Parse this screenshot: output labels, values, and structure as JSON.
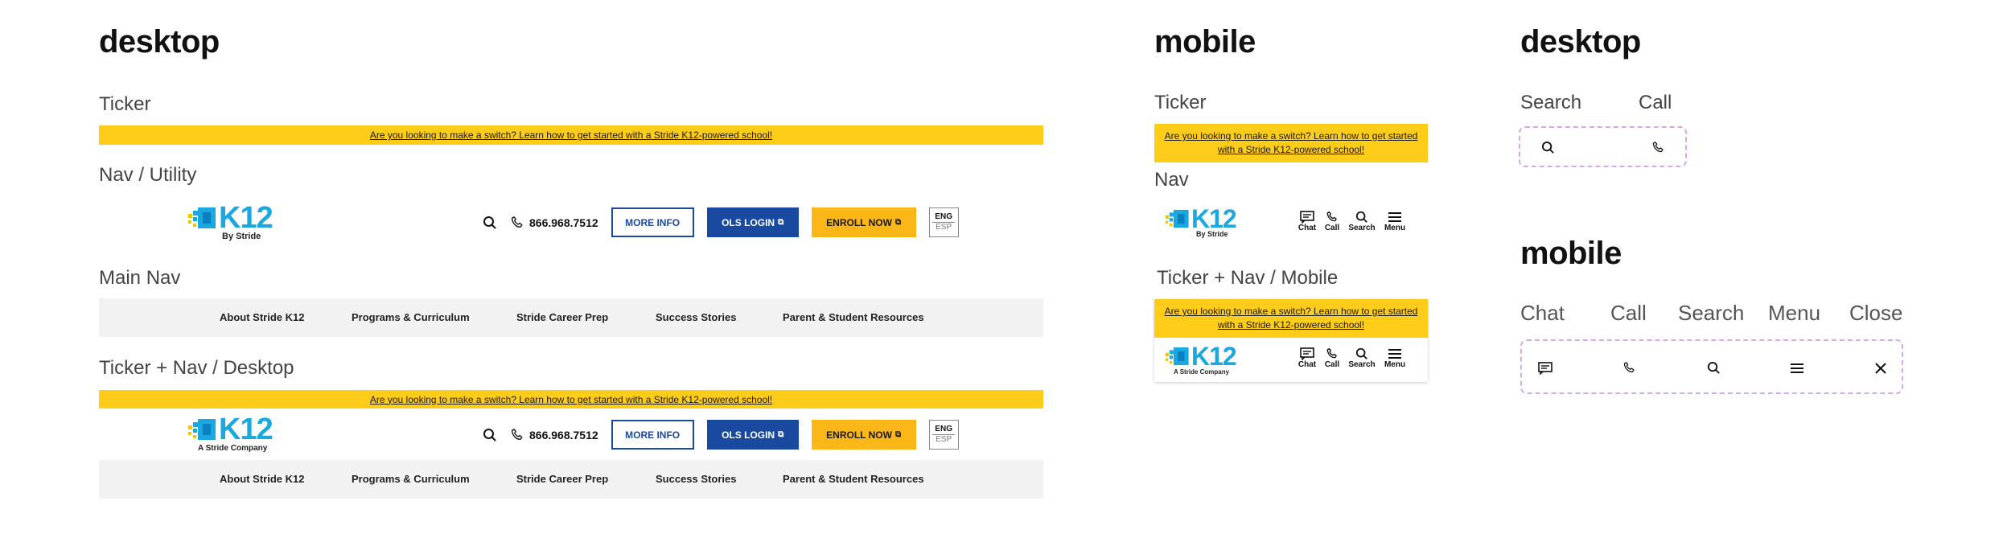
{
  "headings": {
    "desktop1": "desktop",
    "mobile1": "mobile",
    "desktop2": "desktop",
    "mobile2": "mobile"
  },
  "labels": {
    "ticker_d": "Ticker",
    "nav_utility": "Nav / Utility",
    "main_nav": "Main Nav",
    "ticker_nav_desktop": "Ticker + Nav / Desktop",
    "ticker_m": "Ticker",
    "nav_m": "Nav",
    "ticker_nav_mobile": "Ticker + Nav / Mobile",
    "search": "Search",
    "call": "Call",
    "chat": "Chat",
    "call2": "Call",
    "search2": "Search",
    "menu": "Menu",
    "close": "Close"
  },
  "ticker": {
    "desktop_text": "Are you looking to make a switch? Learn how to get started with a Stride K12-powered school!",
    "mobile_line1": "Are you looking to make a switch? Learn how to get started",
    "mobile_line2": "with a Stride K12-powered school!"
  },
  "logo": {
    "text": "K12",
    "sub_by": "By Stride",
    "sub_company": "A Stride Company"
  },
  "utility": {
    "phone": "866.968.7512",
    "more_info": "MORE INFO",
    "ols_login": "OLS LOGIN",
    "enroll_now": "ENROLL NOW",
    "lang_eng": "ENG",
    "lang_esp": "ESP"
  },
  "main_nav": {
    "items": [
      "About Stride K12",
      "Programs & Curriculum",
      "Stride Career Prep",
      "Success Stories",
      "Parent & Student Resources"
    ]
  },
  "mobile_nav": {
    "chat": "Chat",
    "call": "Call",
    "search": "Search",
    "menu": "Menu"
  },
  "colors": {
    "ticker": "#fecd1a",
    "brand_blue": "#1a4aa0",
    "enroll_gold": "#fbb617",
    "logo_cyan": "#1aa8e0"
  }
}
